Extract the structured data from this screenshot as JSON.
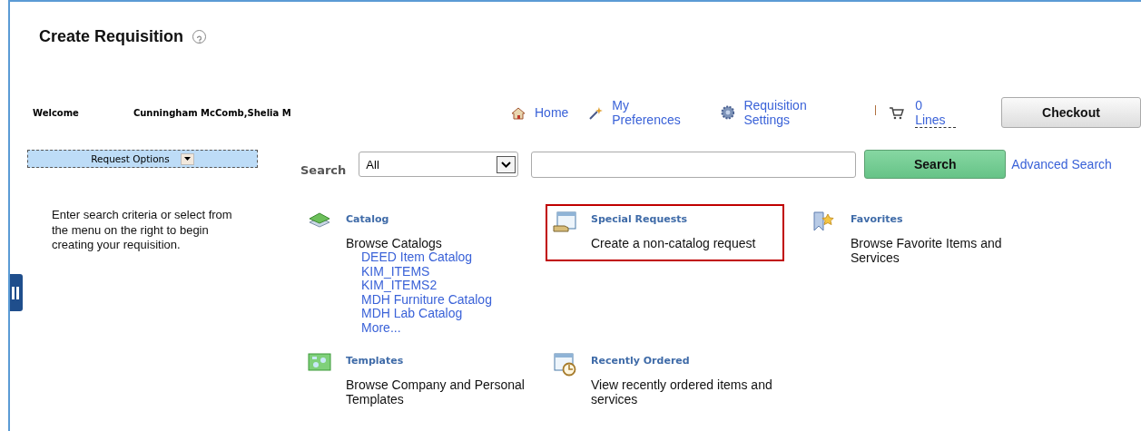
{
  "title": "Create Requisition",
  "welcome": {
    "label": "Welcome",
    "name": "Cunningham McComb,Shelia M"
  },
  "nav": [
    {
      "kind": "home",
      "label": "Home"
    },
    {
      "kind": "wand",
      "label": "My Preferences"
    },
    {
      "kind": "gear",
      "label": "Requisition Settings"
    }
  ],
  "cart": {
    "label": "0 Lines"
  },
  "checkout": "Checkout",
  "request_options": "Request Options",
  "search": {
    "label": "Search",
    "category": "All",
    "button": "Search",
    "advanced": "Advanced Search"
  },
  "instructions": "Enter search criteria or select from the menu on the right to begin creating your requisition.",
  "tiles": [
    {
      "kind": "catalog",
      "title": "Catalog",
      "text": "Browse Catalogs",
      "highlighted": false,
      "links": [
        "DEED Item Catalog",
        "KIM_ITEMS",
        "KIM_ITEMS2",
        "MDH Furniture Catalog",
        "MDH Lab Catalog",
        "More..."
      ]
    },
    {
      "kind": "special",
      "title": "Special Requests",
      "text": "Create a non-catalog request",
      "highlighted": true
    },
    {
      "kind": "favorites",
      "title": "Favorites",
      "text": "Browse Favorite Items and Services",
      "highlighted": false
    },
    {
      "kind": "templates",
      "title": "Templates",
      "text": "Browse Company and Personal Templates",
      "highlighted": false
    },
    {
      "kind": "recent",
      "title": "Recently Ordered",
      "text": "View recently ordered items and services",
      "highlighted": false
    }
  ]
}
